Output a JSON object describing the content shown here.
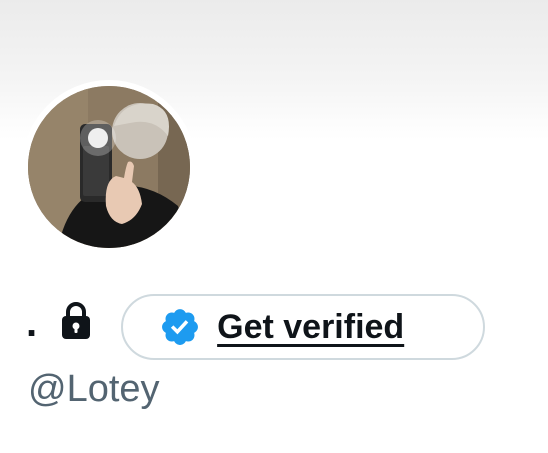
{
  "profile": {
    "display_name": ".",
    "handle": "@Lotey",
    "protected": true,
    "verify_button_label": "Get verified"
  },
  "icons": {
    "lock": "lock-icon",
    "verified": "verified-badge-icon"
  },
  "colors": {
    "verified_blue": "#1d9bf0",
    "text_primary": "#0f1419",
    "text_secondary": "#536471",
    "pill_border": "#cfd9de"
  }
}
